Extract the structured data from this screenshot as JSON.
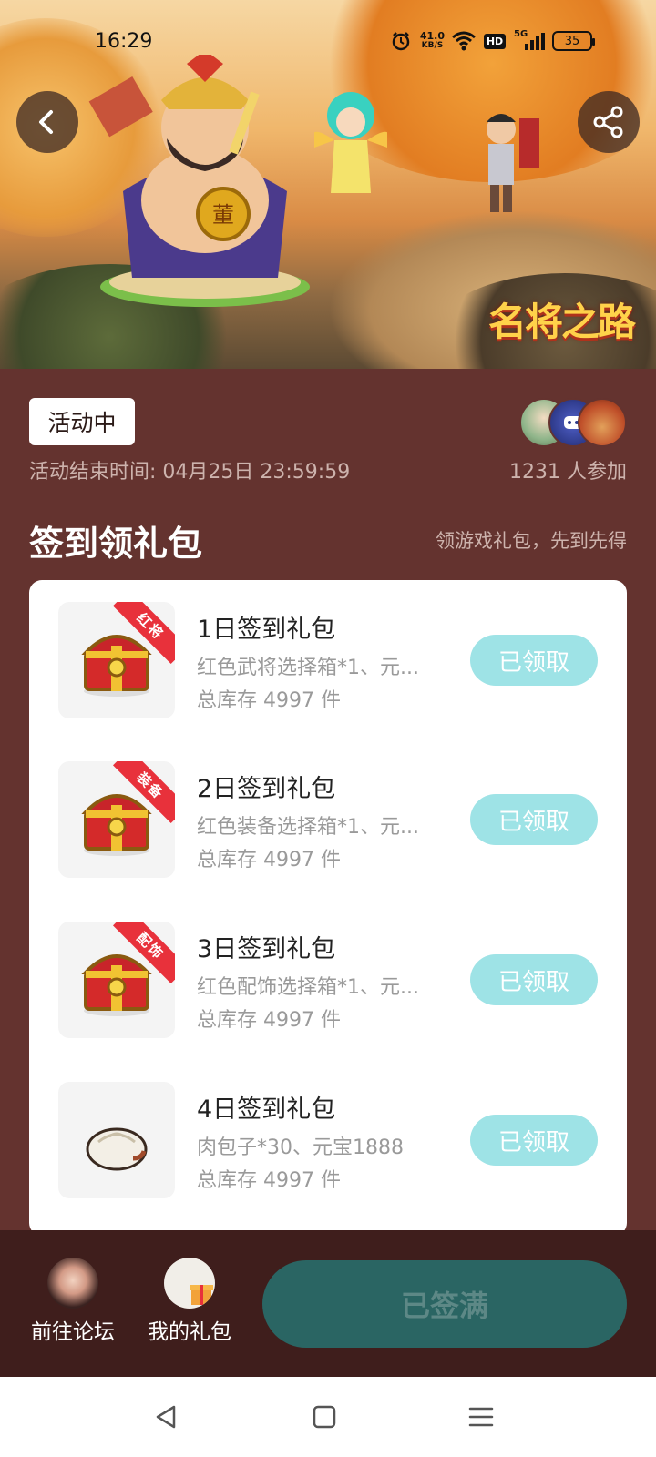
{
  "status_bar": {
    "time": "16:29",
    "net_speed_value": "41.0",
    "net_speed_unit": "KB/S",
    "hd_label": "HD",
    "network_label": "5G",
    "battery": "35"
  },
  "banner": {
    "logo_text": "名将之路"
  },
  "activity": {
    "status_badge": "活动中",
    "end_time": "活动结束时间: 04月25日 23:59:59",
    "participants": "1231 人参加"
  },
  "section": {
    "title": "签到领礼包",
    "subtitle": "领游戏礼包，先到先得"
  },
  "gifts": [
    {
      "name": "1日签到礼包",
      "desc": "红色武将选择箱*1、元...",
      "stock": "总库存 4997 件",
      "button": "已领取",
      "ribbon": "红将",
      "icon": "treasure-chest-icon"
    },
    {
      "name": "2日签到礼包",
      "desc": "红色装备选择箱*1、元...",
      "stock": "总库存 4997 件",
      "button": "已领取",
      "ribbon": "装备",
      "icon": "treasure-chest-icon"
    },
    {
      "name": "3日签到礼包",
      "desc": "红色配饰选择箱*1、元...",
      "stock": "总库存 4997 件",
      "button": "已领取",
      "ribbon": "配饰",
      "icon": "treasure-chest-icon"
    },
    {
      "name": "4日签到礼包",
      "desc": "肉包子*30、元宝1888",
      "stock": "总库存 4997 件",
      "button": "已领取",
      "ribbon": "",
      "icon": "bun-icon"
    }
  ],
  "bottom_bar": {
    "forum_label": "前往论坛",
    "my_gifts_label": "我的礼包",
    "signed_button": "已签满"
  },
  "colors": {
    "background": "#64332f",
    "bottom_bar": "#3f1e1c",
    "claim_button": "#9ee3e6",
    "signed_button": "#2a6563",
    "ribbon": "#e8313b"
  }
}
